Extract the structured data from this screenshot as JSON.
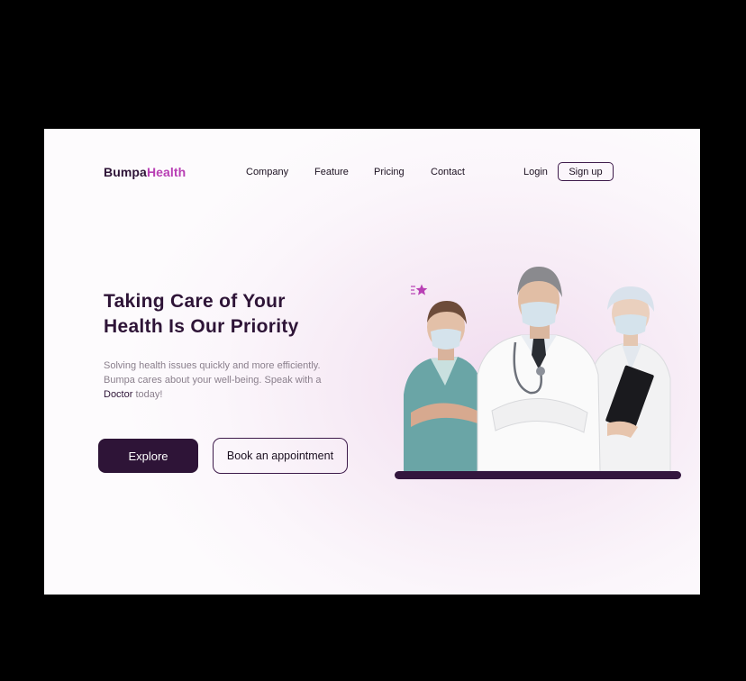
{
  "brand": {
    "part1": "Bumpa",
    "part2": "Health"
  },
  "nav": [
    {
      "label": "Company"
    },
    {
      "label": "Feature"
    },
    {
      "label": "Pricing"
    },
    {
      "label": "Contact"
    }
  ],
  "auth": {
    "login": "Login",
    "signup": "Sign up"
  },
  "hero": {
    "title_line1": "Taking Care of Your",
    "title_line2": "Health Is Our Priority",
    "subtitle_before": "Solving health issues quickly and more efficiently. Bumpa cares about your well-being. Speak with a ",
    "subtitle_highlight": "Doctor",
    "subtitle_after": " today!",
    "explore_label": "Explore",
    "book_label": "Book an appointment"
  },
  "colors": {
    "brand_dark": "#2e1437",
    "brand_accent": "#b83fb4",
    "background": "#fbf3fa"
  },
  "icons": {
    "decor": "star-icon"
  }
}
